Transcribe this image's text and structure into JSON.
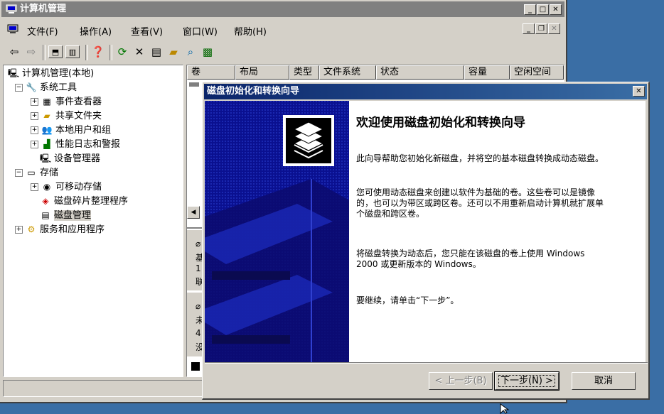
{
  "main_window": {
    "title": "计算机管理",
    "menu": [
      "文件(F)",
      "操作(A)",
      "查看(V)",
      "窗口(W)",
      "帮助(H)"
    ]
  },
  "tree": [
    {
      "label": "计算机管理(本地)",
      "icon": "computer-icon"
    },
    {
      "label": "系统工具",
      "icon": "tools-icon"
    },
    {
      "label": "事件查看器",
      "icon": "event-viewer-icon"
    },
    {
      "label": "共享文件夹",
      "icon": "shared-folder-icon"
    },
    {
      "label": "本地用户和组",
      "icon": "users-icon"
    },
    {
      "label": "性能日志和警报",
      "icon": "performance-icon"
    },
    {
      "label": "设备管理器",
      "icon": "device-manager-icon"
    },
    {
      "label": "存储",
      "icon": "storage-icon"
    },
    {
      "label": "可移动存储",
      "icon": "removable-storage-icon"
    },
    {
      "label": "磁盘碎片整理程序",
      "icon": "defrag-icon"
    },
    {
      "label": "磁盘管理",
      "icon": "disk-management-icon"
    },
    {
      "label": "服务和应用程序",
      "icon": "services-icon"
    }
  ],
  "list_columns": [
    "卷",
    "布局",
    "类型",
    "文件系统",
    "状态",
    "容量",
    "空闲空间"
  ],
  "disk_fragments": {
    "disk0": [
      "基",
      "1!",
      "联"
    ],
    "disk1": [
      "未",
      "4",
      "没"
    ]
  },
  "wizard": {
    "title": "磁盘初始化和转换向导",
    "heading": "欢迎使用磁盘初始化和转换向导",
    "p1": "此向导帮助您初始化新磁盘，并将空的基本磁盘转换成动态磁盘。",
    "p2": "您可使用动态磁盘来创建以软件为基础的卷。这些卷可以是镜像的，也可以为带区或跨区卷。还可以不用重新启动计算机就扩展单个磁盘和跨区卷。",
    "p3": "将磁盘转换为动态后，您只能在该磁盘的卷上使用 Windows 2000 或更新版本的 Windows。",
    "p4": "要继续，请单击“下一步”。",
    "back_button": "< 上一步(B)",
    "next_button": "下一步(N) >",
    "cancel_button": "取消"
  },
  "colors": {
    "titlebar_active": "#0a246a",
    "titlebar_inactive": "#808080",
    "desktop": "#3a6ea5",
    "wizard_side": "#0a1090"
  }
}
